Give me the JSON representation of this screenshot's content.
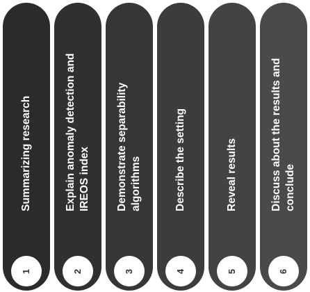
{
  "steps": [
    {
      "number": "1",
      "label": "Summarizing research",
      "color": "#2b2b2b"
    },
    {
      "number": "2",
      "label": "Explain anomaly detection and IREOS index",
      "color": "#303030"
    },
    {
      "number": "3",
      "label": "Demonstrate separability algorithms",
      "color": "#363636"
    },
    {
      "number": "4",
      "label": "Describe the setting",
      "color": "#3c3c3c"
    },
    {
      "number": "5",
      "label": "Reveal results",
      "color": "#434343"
    },
    {
      "number": "6",
      "label": "Discuss about the results and conclude",
      "color": "#4a4a4a"
    }
  ]
}
